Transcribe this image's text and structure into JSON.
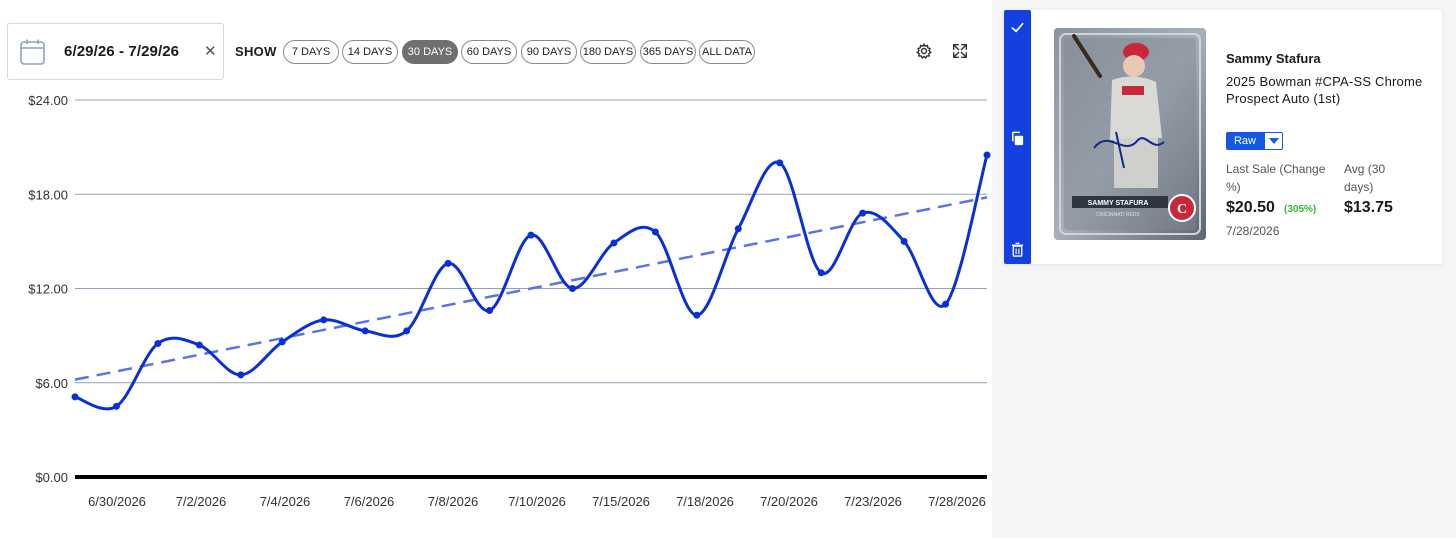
{
  "filters": {
    "date_range": "6/29/26 - 7/29/26",
    "show_label": "SHOW",
    "ranges": [
      "7 DAYS",
      "14 DAYS",
      "30 DAYS",
      "60 DAYS",
      "90 DAYS",
      "180 DAYS",
      "365 DAYS",
      "ALL DATA"
    ],
    "active_range": "30 DAYS"
  },
  "chart_data": {
    "type": "line",
    "x_tick_labels": [
      "6/30/2026",
      "7/2/2026",
      "7/4/2026",
      "7/6/2026",
      "7/8/2026",
      "7/10/2026",
      "7/15/2026",
      "7/18/2026",
      "7/20/2026",
      "7/23/2026",
      "7/28/2026"
    ],
    "y_tick_labels": [
      "$0.00",
      "$6.00",
      "$12.00",
      "$18.00",
      "$24.00"
    ],
    "ylim": [
      0,
      24
    ],
    "grid": true,
    "series": [
      {
        "kind": "price",
        "color": "#0a2fd6",
        "values": [
          5.1,
          4.5,
          8.5,
          8.4,
          6.5,
          8.6,
          10.0,
          9.3,
          9.3,
          13.6,
          10.6,
          15.4,
          12.0,
          14.9,
          15.6,
          10.3,
          15.8,
          20.0,
          13.0,
          16.8,
          15.0,
          11.0,
          20.5
        ]
      },
      {
        "kind": "trendline",
        "style": "dashed",
        "color": "#5b73e8",
        "values": [
          6.2,
          17.8
        ]
      }
    ]
  },
  "card": {
    "player": "Sammy Stafura",
    "title": "2025 Bowman #CPA-SS Chrome Prospect Auto (1st)",
    "grade": "Raw",
    "last_sale_label": "Last Sale (Change %)",
    "last_sale_price": "$20.50",
    "change_pct": "(305%)",
    "avg_label": "Avg (30 days)",
    "avg_price": "$13.75",
    "sale_date": "7/28/2026",
    "image_name_plate": "SAMMY STAFURA",
    "image_team_text": "CINCINNATI REDS"
  },
  "colors": {
    "accent": "#1440e0",
    "line": "#0a2fd6",
    "trend": "#5b73e8",
    "positive": "#3ab53a"
  }
}
